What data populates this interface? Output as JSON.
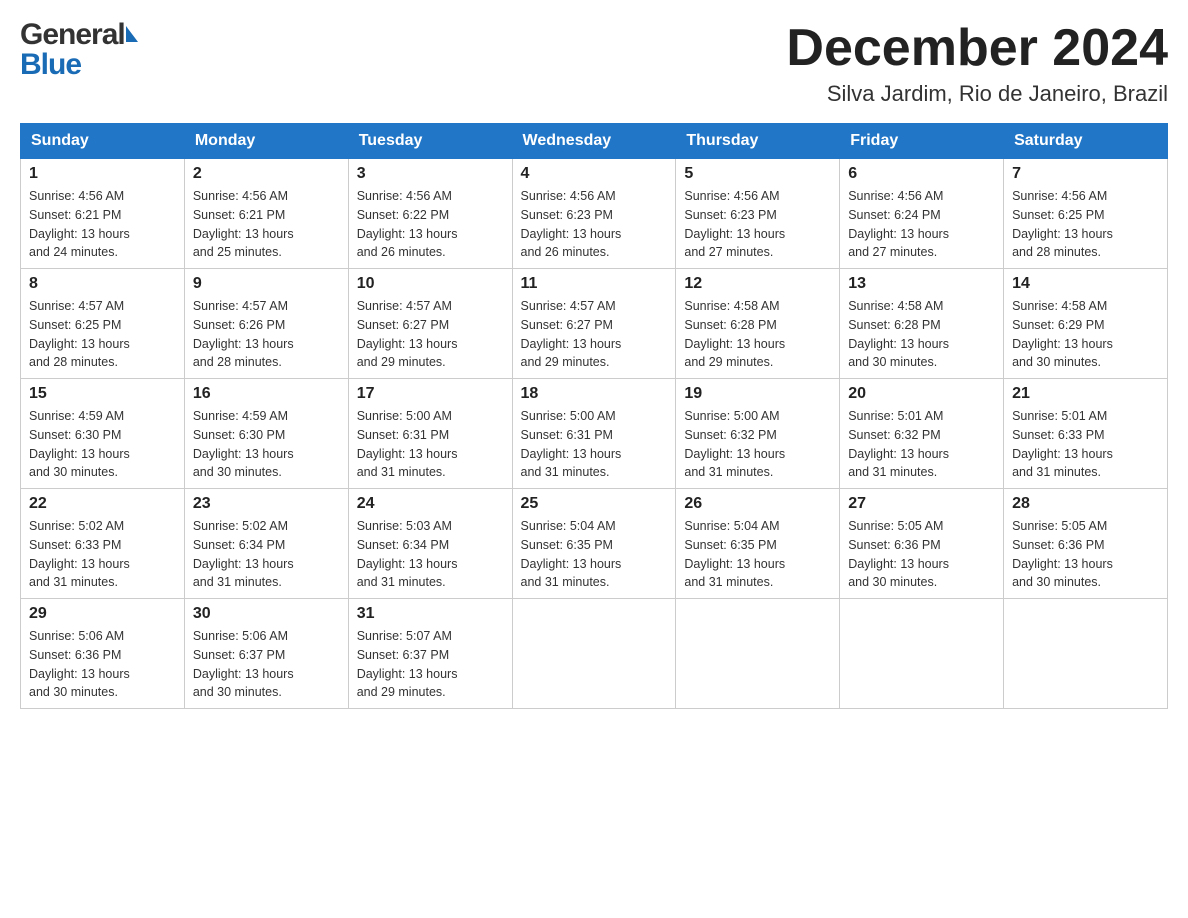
{
  "header": {
    "logo_general": "General",
    "logo_blue": "Blue",
    "month_title": "December 2024",
    "location": "Silva Jardim, Rio de Janeiro, Brazil"
  },
  "weekdays": [
    "Sunday",
    "Monday",
    "Tuesday",
    "Wednesday",
    "Thursday",
    "Friday",
    "Saturday"
  ],
  "weeks": [
    [
      {
        "day": "1",
        "sunrise": "4:56 AM",
        "sunset": "6:21 PM",
        "daylight": "13 hours and 24 minutes."
      },
      {
        "day": "2",
        "sunrise": "4:56 AM",
        "sunset": "6:21 PM",
        "daylight": "13 hours and 25 minutes."
      },
      {
        "day": "3",
        "sunrise": "4:56 AM",
        "sunset": "6:22 PM",
        "daylight": "13 hours and 26 minutes."
      },
      {
        "day": "4",
        "sunrise": "4:56 AM",
        "sunset": "6:23 PM",
        "daylight": "13 hours and 26 minutes."
      },
      {
        "day": "5",
        "sunrise": "4:56 AM",
        "sunset": "6:23 PM",
        "daylight": "13 hours and 27 minutes."
      },
      {
        "day": "6",
        "sunrise": "4:56 AM",
        "sunset": "6:24 PM",
        "daylight": "13 hours and 27 minutes."
      },
      {
        "day": "7",
        "sunrise": "4:56 AM",
        "sunset": "6:25 PM",
        "daylight": "13 hours and 28 minutes."
      }
    ],
    [
      {
        "day": "8",
        "sunrise": "4:57 AM",
        "sunset": "6:25 PM",
        "daylight": "13 hours and 28 minutes."
      },
      {
        "day": "9",
        "sunrise": "4:57 AM",
        "sunset": "6:26 PM",
        "daylight": "13 hours and 28 minutes."
      },
      {
        "day": "10",
        "sunrise": "4:57 AM",
        "sunset": "6:27 PM",
        "daylight": "13 hours and 29 minutes."
      },
      {
        "day": "11",
        "sunrise": "4:57 AM",
        "sunset": "6:27 PM",
        "daylight": "13 hours and 29 minutes."
      },
      {
        "day": "12",
        "sunrise": "4:58 AM",
        "sunset": "6:28 PM",
        "daylight": "13 hours and 29 minutes."
      },
      {
        "day": "13",
        "sunrise": "4:58 AM",
        "sunset": "6:28 PM",
        "daylight": "13 hours and 30 minutes."
      },
      {
        "day": "14",
        "sunrise": "4:58 AM",
        "sunset": "6:29 PM",
        "daylight": "13 hours and 30 minutes."
      }
    ],
    [
      {
        "day": "15",
        "sunrise": "4:59 AM",
        "sunset": "6:30 PM",
        "daylight": "13 hours and 30 minutes."
      },
      {
        "day": "16",
        "sunrise": "4:59 AM",
        "sunset": "6:30 PM",
        "daylight": "13 hours and 30 minutes."
      },
      {
        "day": "17",
        "sunrise": "5:00 AM",
        "sunset": "6:31 PM",
        "daylight": "13 hours and 31 minutes."
      },
      {
        "day": "18",
        "sunrise": "5:00 AM",
        "sunset": "6:31 PM",
        "daylight": "13 hours and 31 minutes."
      },
      {
        "day": "19",
        "sunrise": "5:00 AM",
        "sunset": "6:32 PM",
        "daylight": "13 hours and 31 minutes."
      },
      {
        "day": "20",
        "sunrise": "5:01 AM",
        "sunset": "6:32 PM",
        "daylight": "13 hours and 31 minutes."
      },
      {
        "day": "21",
        "sunrise": "5:01 AM",
        "sunset": "6:33 PM",
        "daylight": "13 hours and 31 minutes."
      }
    ],
    [
      {
        "day": "22",
        "sunrise": "5:02 AM",
        "sunset": "6:33 PM",
        "daylight": "13 hours and 31 minutes."
      },
      {
        "day": "23",
        "sunrise": "5:02 AM",
        "sunset": "6:34 PM",
        "daylight": "13 hours and 31 minutes."
      },
      {
        "day": "24",
        "sunrise": "5:03 AM",
        "sunset": "6:34 PM",
        "daylight": "13 hours and 31 minutes."
      },
      {
        "day": "25",
        "sunrise": "5:04 AM",
        "sunset": "6:35 PM",
        "daylight": "13 hours and 31 minutes."
      },
      {
        "day": "26",
        "sunrise": "5:04 AM",
        "sunset": "6:35 PM",
        "daylight": "13 hours and 31 minutes."
      },
      {
        "day": "27",
        "sunrise": "5:05 AM",
        "sunset": "6:36 PM",
        "daylight": "13 hours and 30 minutes."
      },
      {
        "day": "28",
        "sunrise": "5:05 AM",
        "sunset": "6:36 PM",
        "daylight": "13 hours and 30 minutes."
      }
    ],
    [
      {
        "day": "29",
        "sunrise": "5:06 AM",
        "sunset": "6:36 PM",
        "daylight": "13 hours and 30 minutes."
      },
      {
        "day": "30",
        "sunrise": "5:06 AM",
        "sunset": "6:37 PM",
        "daylight": "13 hours and 30 minutes."
      },
      {
        "day": "31",
        "sunrise": "5:07 AM",
        "sunset": "6:37 PM",
        "daylight": "13 hours and 29 minutes."
      },
      null,
      null,
      null,
      null
    ]
  ]
}
